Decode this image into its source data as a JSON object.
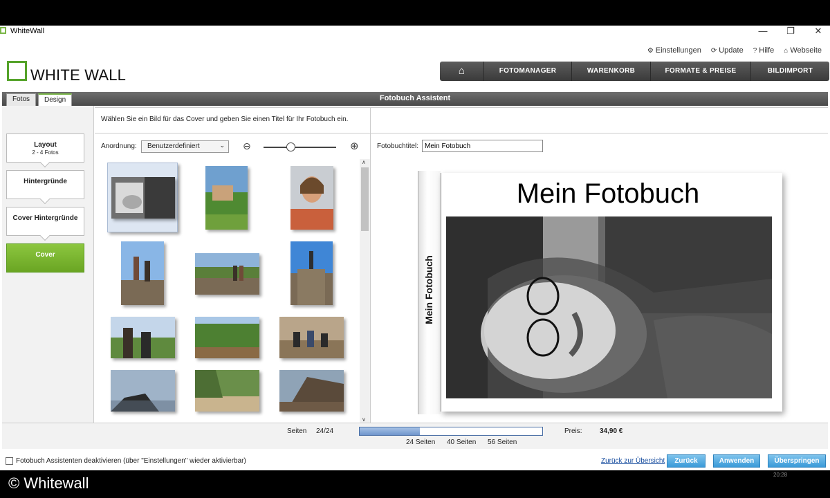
{
  "window": {
    "title": "WhiteWall",
    "minimize": "—",
    "maximize": "❐",
    "close": "✕"
  },
  "toplinks": [
    {
      "icon": "gear-icon",
      "glyph": "⚙",
      "label": "Einstellungen"
    },
    {
      "icon": "update-icon",
      "glyph": "⟳",
      "label": "Update"
    },
    {
      "icon": "help-icon",
      "glyph": "?",
      "label": "Hilfe"
    },
    {
      "icon": "home-icon",
      "glyph": "⌂",
      "label": "Webseite"
    }
  ],
  "logo": {
    "text": "WHITE WALL"
  },
  "mainnav": {
    "home_glyph": "⌂",
    "items": [
      "FOTOMANAGER",
      "WARENKORB",
      "FORMATE & PREISE",
      "BILDIMPORT"
    ]
  },
  "assistant": {
    "title": "Fotobuch Assistent",
    "tabs": [
      "Fotos",
      "Design"
    ],
    "active_tab": "Design",
    "instruction": "Wählen Sie ein Bild für das Cover und geben Sie einen Titel für Ihr Fotobuch ein."
  },
  "steps": [
    {
      "label": "Layout",
      "sub": "2 - 4 Fotos"
    },
    {
      "label": "Hintergründe",
      "sub": ""
    },
    {
      "label": "Cover Hintergründe",
      "sub": ""
    },
    {
      "label": "Cover",
      "sub": ""
    }
  ],
  "active_step": "Cover",
  "arrangement": {
    "label": "Anordnung:",
    "value": "Benutzerdefiniert"
  },
  "zoom": {
    "level": 0.37
  },
  "book_title": {
    "label": "Fotobuchtitel:",
    "value": "Mein Fotobuch"
  },
  "cover": {
    "title": "Mein Fotobuch",
    "spine": "Mein Fotobuch"
  },
  "footer": {
    "pages_label": "Seiten",
    "pages_value": "24/24",
    "progress": 0.33,
    "ticks": [
      "24 Seiten",
      "40 Seiten",
      "56 Seiten"
    ],
    "price_label": "Preis:",
    "price_value": "34,90 €"
  },
  "bottom": {
    "checkbox_label": "Fotobuch Assistenten deaktivieren (über \"Einstellungen\" wieder aktivierbar)",
    "back_link": "Zurück zur Übersicht",
    "buttons": [
      "Zurück",
      "Anwenden",
      "Überspringen"
    ]
  },
  "credit": "© Whitewall",
  "clock": "20:28"
}
